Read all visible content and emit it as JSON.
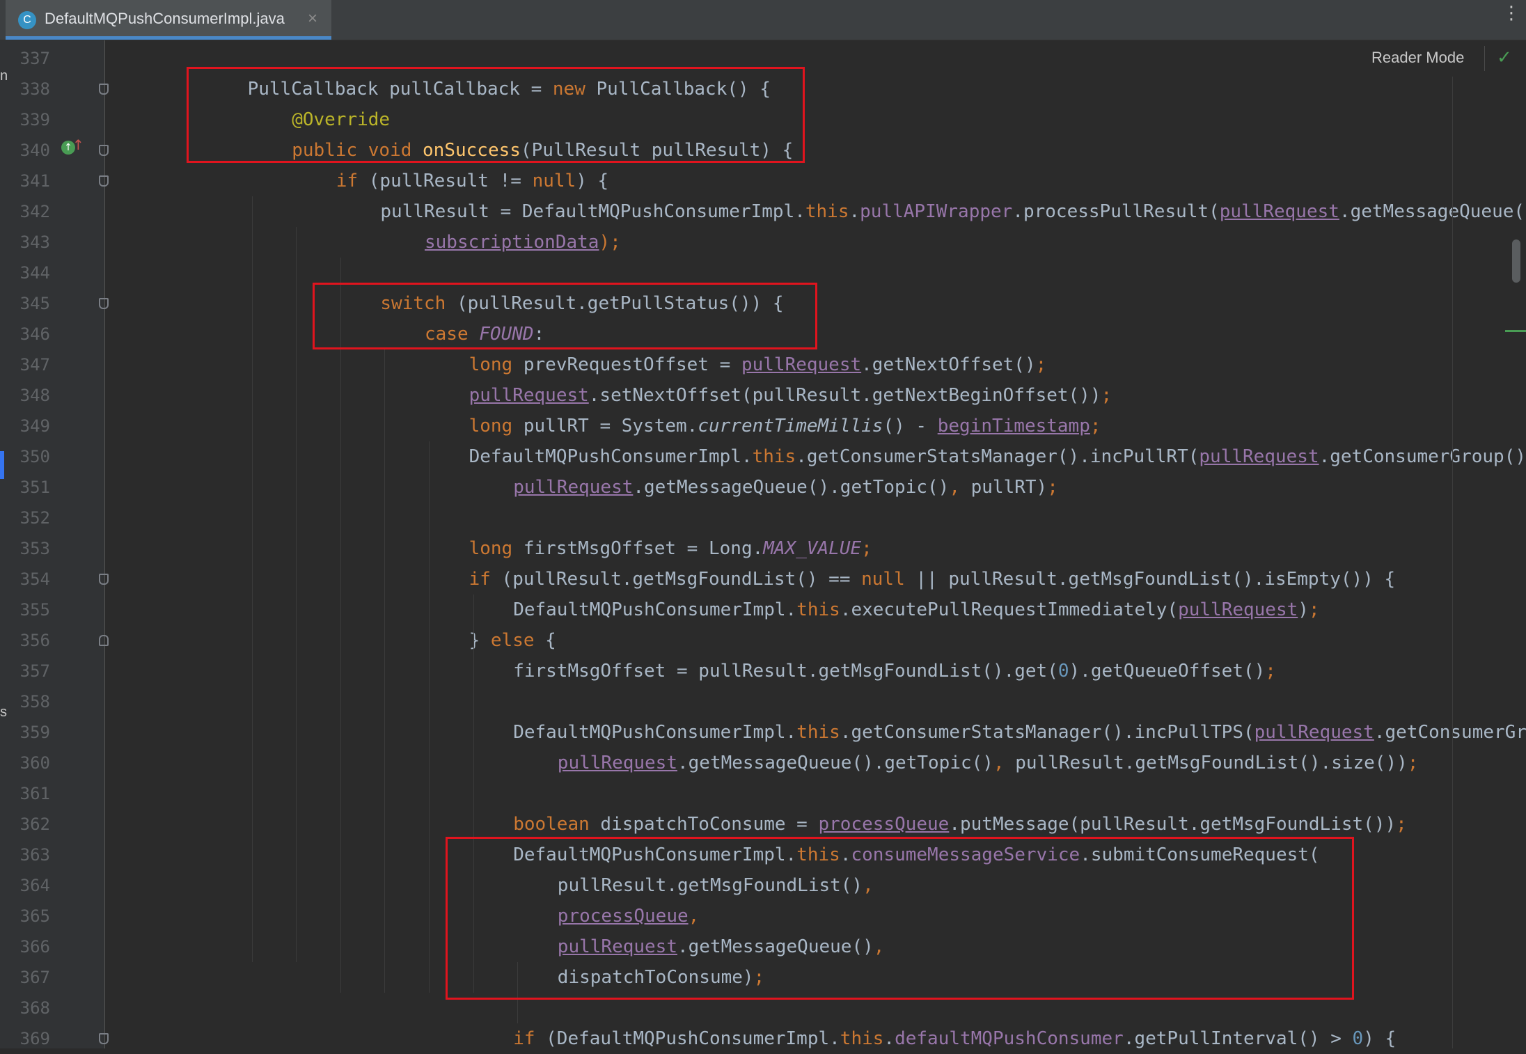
{
  "tab": {
    "title": "DefaultMQPushConsumerImpl.java",
    "icon_letter": "C",
    "close_glyph": "×"
  },
  "toolbar": {
    "reader_mode": "Reader Mode",
    "check_glyph": "✓",
    "more_glyph": "⋮"
  },
  "left_fragments": [
    "n",
    "s"
  ],
  "lines": [
    {
      "n": "337",
      "indent": 0,
      "tokens": []
    },
    {
      "n": "338",
      "indent": 1,
      "tokens": [
        [
          "PullCallback pullCallback = ",
          "plain"
        ],
        [
          "new",
          "kw"
        ],
        [
          " PullCallback() {",
          "plain"
        ]
      ]
    },
    {
      "n": "339",
      "indent": 2,
      "tokens": [
        [
          "@Override",
          "ann"
        ]
      ]
    },
    {
      "n": "340",
      "indent": 2,
      "tokens": [
        [
          "public void ",
          "kw"
        ],
        [
          "onSuccess",
          "fn"
        ],
        [
          "(PullResult pullResult) {",
          "plain"
        ]
      ]
    },
    {
      "n": "341",
      "indent": 3,
      "tokens": [
        [
          "if",
          "kw"
        ],
        [
          " (pullResult != ",
          "plain"
        ],
        [
          "null",
          "kw"
        ],
        [
          ") {",
          "plain"
        ]
      ]
    },
    {
      "n": "342",
      "indent": 4,
      "tokens": [
        [
          "pullResult = DefaultMQPushConsumerImpl.",
          "plain"
        ],
        [
          "this",
          "kw"
        ],
        [
          ".",
          "plain"
        ],
        [
          "pullAPIWrapper",
          "field"
        ],
        [
          ".processPullResult(",
          "plain"
        ],
        [
          "pullRequest",
          "ul"
        ],
        [
          ".getMessageQueue()",
          "plain"
        ],
        [
          ",",
          "punc"
        ]
      ]
    },
    {
      "n": "343",
      "indent": 5,
      "tokens": [
        [
          "subscriptionData",
          "ul"
        ],
        [
          ");",
          "punc"
        ]
      ]
    },
    {
      "n": "344",
      "indent": 0,
      "tokens": []
    },
    {
      "n": "345",
      "indent": 4,
      "tokens": [
        [
          "switch",
          "kw"
        ],
        [
          " (pullResult.getPullStatus()) {",
          "plain"
        ]
      ]
    },
    {
      "n": "346",
      "indent": 5,
      "tokens": [
        [
          "case ",
          "kw"
        ],
        [
          "FOUND",
          "static"
        ],
        [
          ":",
          "plain"
        ]
      ]
    },
    {
      "n": "347",
      "indent": 6,
      "tokens": [
        [
          "long",
          "kw"
        ],
        [
          " prevRequestOffset = ",
          "plain"
        ],
        [
          "pullRequest",
          "ul"
        ],
        [
          ".getNextOffset()",
          "plain"
        ],
        [
          ";",
          "punc"
        ]
      ]
    },
    {
      "n": "348",
      "indent": 6,
      "tokens": [
        [
          "pullRequest",
          "ul"
        ],
        [
          ".setNextOffset(pullResult.getNextBeginOffset())",
          "plain"
        ],
        [
          ";",
          "punc"
        ]
      ]
    },
    {
      "n": "349",
      "indent": 6,
      "tokens": [
        [
          "long",
          "kw"
        ],
        [
          " pullRT = System.",
          "plain"
        ],
        [
          "currentTimeMillis",
          "italic"
        ],
        [
          "() - ",
          "plain"
        ],
        [
          "beginTimestamp",
          "ul"
        ],
        [
          ";",
          "punc"
        ]
      ]
    },
    {
      "n": "350",
      "indent": 6,
      "tokens": [
        [
          "DefaultMQPushConsumerImpl.",
          "plain"
        ],
        [
          "this",
          "kw"
        ],
        [
          ".getConsumerStatsManager().incPullRT(",
          "plain"
        ],
        [
          "pullRequest",
          "ul"
        ],
        [
          ".getConsumerGroup()",
          "plain"
        ],
        [
          ",",
          "punc"
        ]
      ]
    },
    {
      "n": "351",
      "indent": 7,
      "tokens": [
        [
          "pullRequest",
          "ul"
        ],
        [
          ".getMessageQueue().getTopic()",
          "plain"
        ],
        [
          ", ",
          "punc"
        ],
        [
          "pullRT)",
          "plain"
        ],
        [
          ";",
          "punc"
        ]
      ]
    },
    {
      "n": "352",
      "indent": 0,
      "tokens": []
    },
    {
      "n": "353",
      "indent": 6,
      "tokens": [
        [
          "long",
          "kw"
        ],
        [
          " firstMsgOffset = Long.",
          "plain"
        ],
        [
          "MAX_VALUE",
          "static"
        ],
        [
          ";",
          "punc"
        ]
      ]
    },
    {
      "n": "354",
      "indent": 6,
      "tokens": [
        [
          "if",
          "kw"
        ],
        [
          " (pullResult.getMsgFoundList() == ",
          "plain"
        ],
        [
          "null",
          "kw"
        ],
        [
          " || pullResult.getMsgFoundList().isEmpty()) {",
          "plain"
        ]
      ]
    },
    {
      "n": "355",
      "indent": 7,
      "tokens": [
        [
          "DefaultMQPushConsumerImpl.",
          "plain"
        ],
        [
          "this",
          "kw"
        ],
        [
          ".executePullRequestImmediately(",
          "plain"
        ],
        [
          "pullRequest",
          "ul"
        ],
        [
          ")",
          "plain"
        ],
        [
          ";",
          "punc"
        ]
      ]
    },
    {
      "n": "356",
      "indent": 6,
      "tokens": [
        [
          "} ",
          "plain"
        ],
        [
          "else",
          "kw"
        ],
        [
          " {",
          "plain"
        ]
      ]
    },
    {
      "n": "357",
      "indent": 7,
      "tokens": [
        [
          "firstMsgOffset = pullResult.getMsgFoundList().get(",
          "plain"
        ],
        [
          "0",
          "num"
        ],
        [
          ").getQueueOffset()",
          "plain"
        ],
        [
          ";",
          "punc"
        ]
      ]
    },
    {
      "n": "358",
      "indent": 0,
      "tokens": []
    },
    {
      "n": "359",
      "indent": 7,
      "tokens": [
        [
          "DefaultMQPushConsumerImpl.",
          "plain"
        ],
        [
          "this",
          "kw"
        ],
        [
          ".getConsumerStatsManager().incPullTPS(",
          "plain"
        ],
        [
          "pullRequest",
          "ul"
        ],
        [
          ".getConsumerGrou",
          "plain"
        ]
      ]
    },
    {
      "n": "360",
      "indent": 8,
      "tokens": [
        [
          "pullRequest",
          "ul"
        ],
        [
          ".getMessageQueue().getTopic()",
          "plain"
        ],
        [
          ", ",
          "punc"
        ],
        [
          "pullResult.getMsgFoundList().size())",
          "plain"
        ],
        [
          ";",
          "punc"
        ]
      ]
    },
    {
      "n": "361",
      "indent": 0,
      "tokens": []
    },
    {
      "n": "362",
      "indent": 7,
      "tokens": [
        [
          "boolean",
          "kw"
        ],
        [
          " dispatchToConsume = ",
          "plain"
        ],
        [
          "processQueue",
          "ul"
        ],
        [
          ".putMessage(pullResult.getMsgFoundList())",
          "plain"
        ],
        [
          ";",
          "punc"
        ]
      ]
    },
    {
      "n": "363",
      "indent": 7,
      "tokens": [
        [
          "DefaultMQPushConsumerImpl.",
          "plain"
        ],
        [
          "this",
          "kw"
        ],
        [
          ".",
          "plain"
        ],
        [
          "consumeMessageService",
          "field"
        ],
        [
          ".submitConsumeRequest(",
          "plain"
        ]
      ]
    },
    {
      "n": "364",
      "indent": 8,
      "tokens": [
        [
          "pullResult.getMsgFoundList()",
          "plain"
        ],
        [
          ",",
          "punc"
        ]
      ]
    },
    {
      "n": "365",
      "indent": 8,
      "tokens": [
        [
          "processQueue",
          "ul"
        ],
        [
          ",",
          "punc"
        ]
      ]
    },
    {
      "n": "366",
      "indent": 8,
      "tokens": [
        [
          "pullRequest",
          "ul"
        ],
        [
          ".getMessageQueue()",
          "plain"
        ],
        [
          ",",
          "punc"
        ]
      ]
    },
    {
      "n": "367",
      "indent": 8,
      "tokens": [
        [
          "dispatchToConsume)",
          "plain"
        ],
        [
          ";",
          "punc"
        ]
      ]
    },
    {
      "n": "368",
      "indent": 0,
      "tokens": []
    },
    {
      "n": "369",
      "indent": 7,
      "tokens": [
        [
          "if",
          "kw"
        ],
        [
          " (DefaultMQPushConsumerImpl.",
          "plain"
        ],
        [
          "this",
          "kw"
        ],
        [
          ".",
          "plain"
        ],
        [
          "defaultMQPushConsumer",
          "field"
        ],
        [
          ".getPullInterval() > ",
          "plain"
        ],
        [
          "0",
          "num"
        ],
        [
          ") {",
          "plain"
        ]
      ]
    }
  ]
}
